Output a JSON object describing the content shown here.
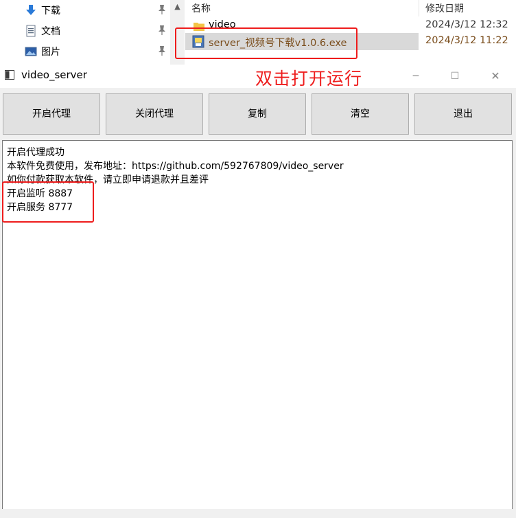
{
  "explorer": {
    "nav_items": [
      {
        "label": "下载",
        "icon": "download-arrow-icon"
      },
      {
        "label": "文档",
        "icon": "document-icon"
      },
      {
        "label": "图片",
        "icon": "pictures-icon"
      }
    ],
    "columns": {
      "name": "名称",
      "modified": "修改日期"
    },
    "files": [
      {
        "name": "video",
        "modified": "2024/3/12 12:32",
        "icon": "folder-icon"
      },
      {
        "name": "server_视频号下载v1.0.6.exe",
        "modified": "2024/3/12 11:22",
        "icon": "exe-icon"
      }
    ]
  },
  "app": {
    "title": "video_server",
    "annotation": "双击打开运行",
    "window_controls": {
      "minimize": "─",
      "maximize": "☐",
      "close": "✕"
    },
    "buttons": {
      "start_proxy": "开启代理",
      "stop_proxy": "关闭代理",
      "copy": "复制",
      "clear": "清空",
      "exit": "退出"
    },
    "log_lines": [
      "开启代理成功",
      "本软件免费使用，发布地址：https://github.com/592767809/video_server",
      "如你付款获取本软件，请立即申请退款并且差评",
      "开启监听 8887",
      "开启服务 8777"
    ]
  },
  "colors": {
    "annotation_red": "#ee1c1c",
    "selected_row": "#d9d9d9",
    "exe_text": "#7a4d1c",
    "button_face": "#e1e1e1",
    "window_bg": "#f0f0f0"
  }
}
